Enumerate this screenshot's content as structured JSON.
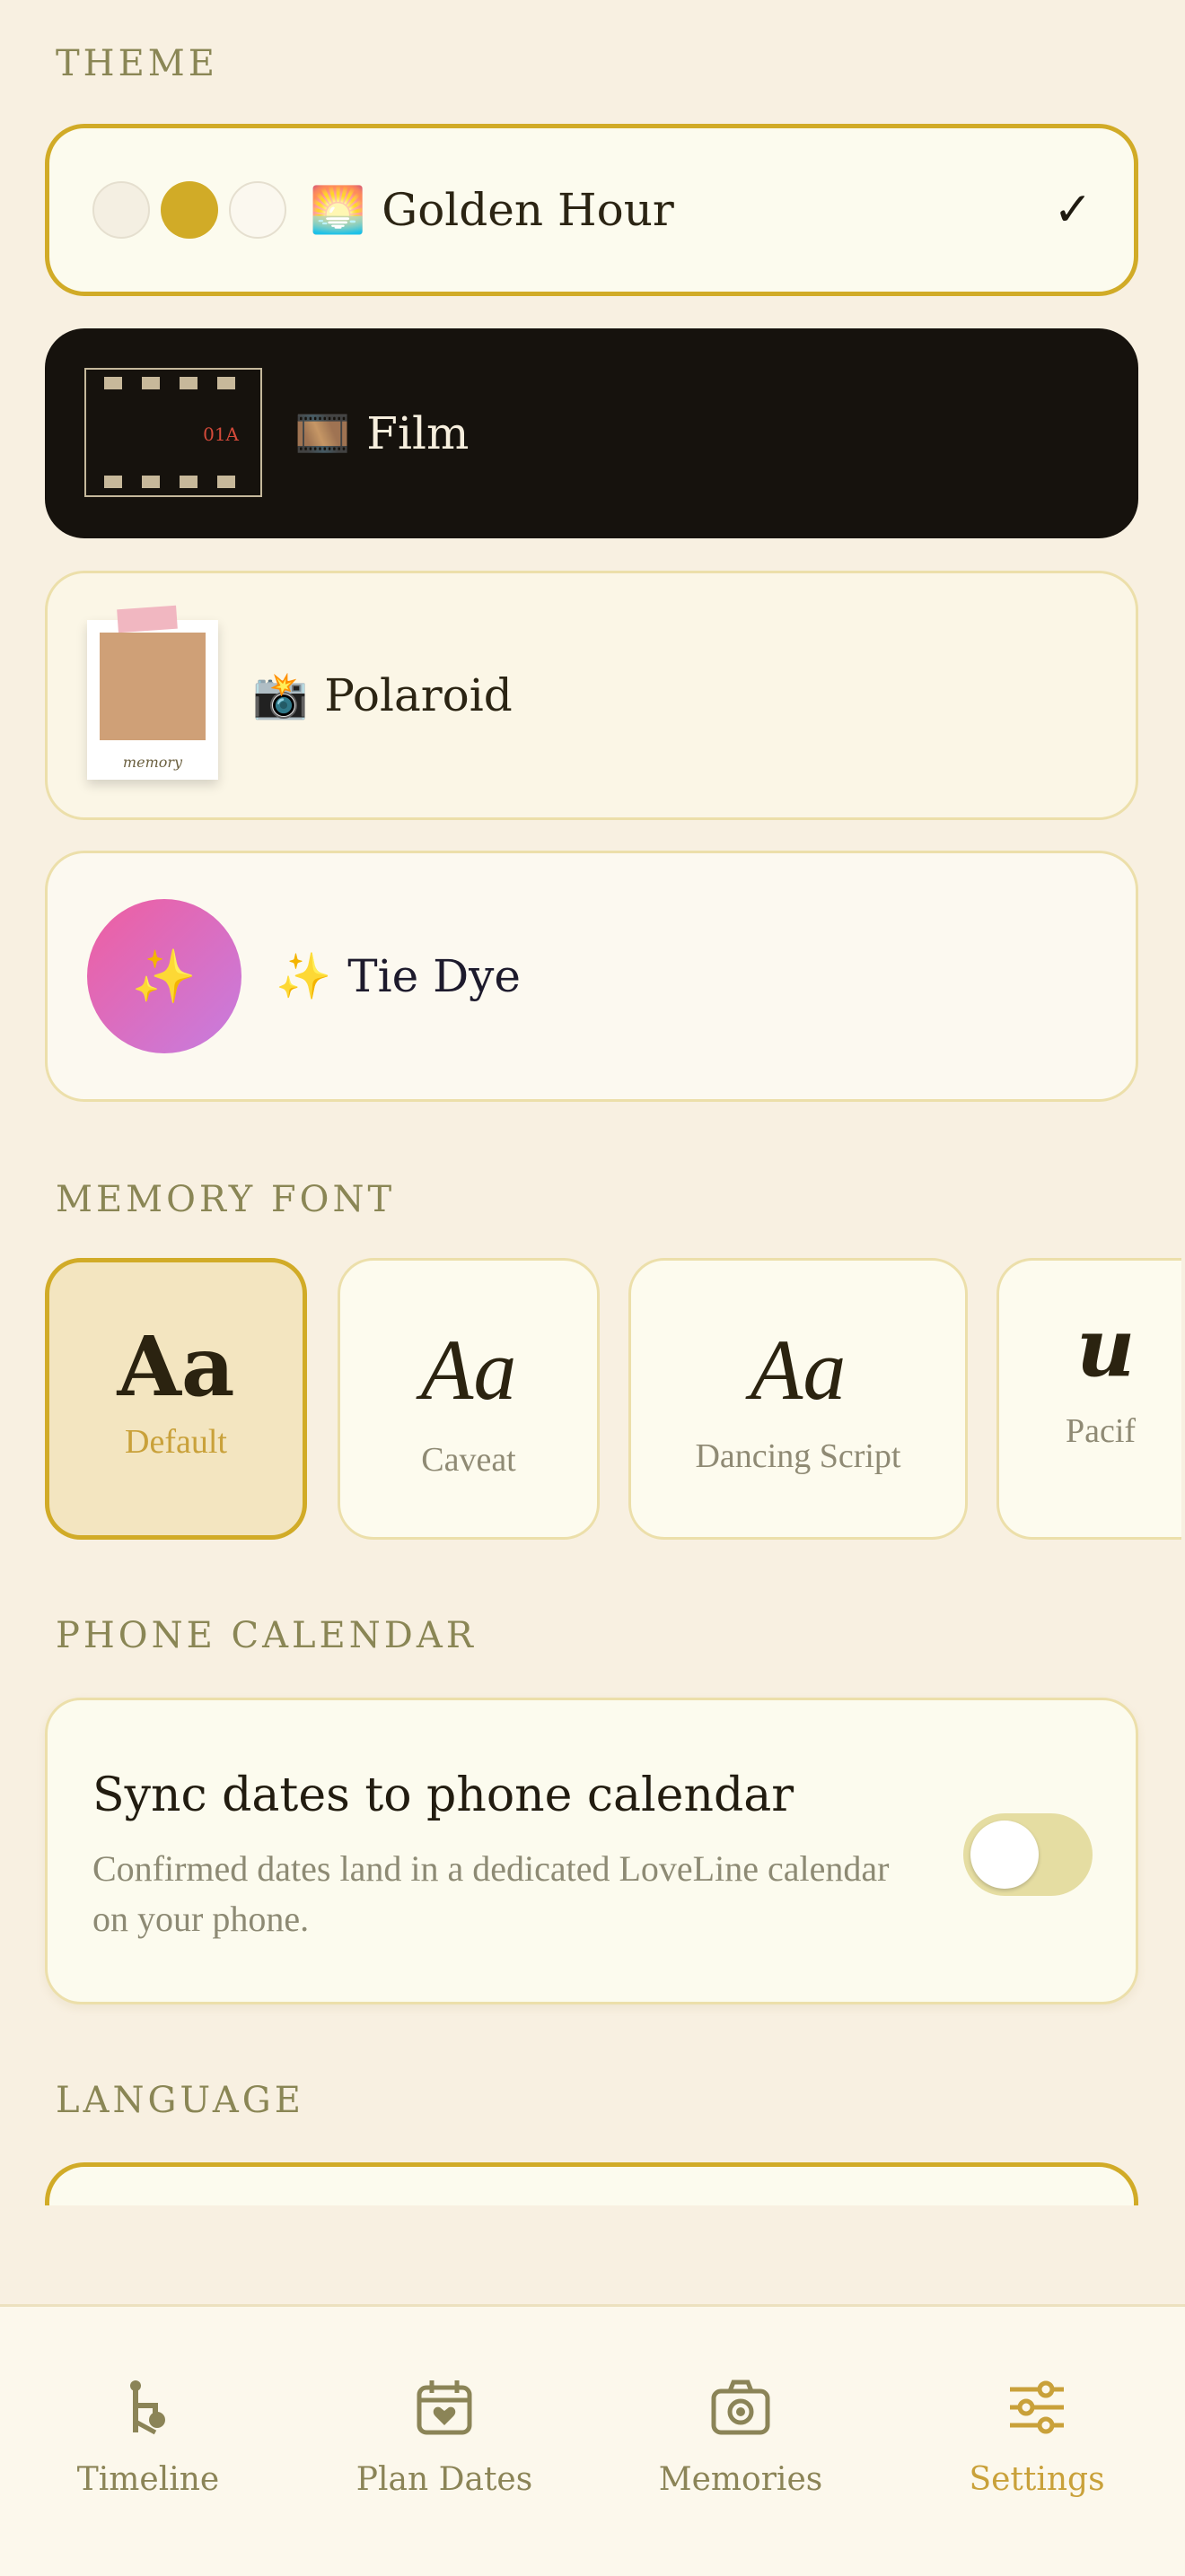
{
  "sections": {
    "theme": "THEME",
    "memory_font": "MEMORY FONT",
    "phone_calendar": "PHONE CALENDAR",
    "language": "LANGUAGE"
  },
  "themes": [
    {
      "name": "Golden Hour",
      "emoji": "🌅",
      "selected": true,
      "check": "✓",
      "swatch_colors": [
        "#f4efe2",
        "#d1ab27",
        "#fbf8ef"
      ]
    },
    {
      "name": "Film",
      "emoji": "🎞️",
      "thumb_code": "01A"
    },
    {
      "name": "Polaroid",
      "emoji": "📸",
      "thumb_caption": "memory"
    },
    {
      "name": "Tie Dye",
      "emoji": "✨",
      "thumb_icon": "✨"
    }
  ],
  "fonts": [
    {
      "sample": "Aa",
      "label": "Default",
      "selected": true
    },
    {
      "sample": "Aa",
      "label": "Caveat"
    },
    {
      "sample": "Aa",
      "label": "Dancing Script"
    },
    {
      "sample": "u",
      "label": "Pacif"
    }
  ],
  "calendar": {
    "title": "Sync dates to phone calendar",
    "description": "Confirmed dates land in a dedicated LoveLine calendar on your phone.",
    "enabled": false
  },
  "nav": [
    {
      "label": "Timeline",
      "icon": "timeline-icon"
    },
    {
      "label": "Plan Dates",
      "icon": "calendar-heart-icon"
    },
    {
      "label": "Memories",
      "icon": "camera-icon"
    },
    {
      "label": "Settings",
      "icon": "sliders-icon",
      "active": true
    }
  ],
  "colors": {
    "accent": "#d1ab27",
    "background": "#f8f0e1",
    "inactive_nav": "#8b8457"
  }
}
